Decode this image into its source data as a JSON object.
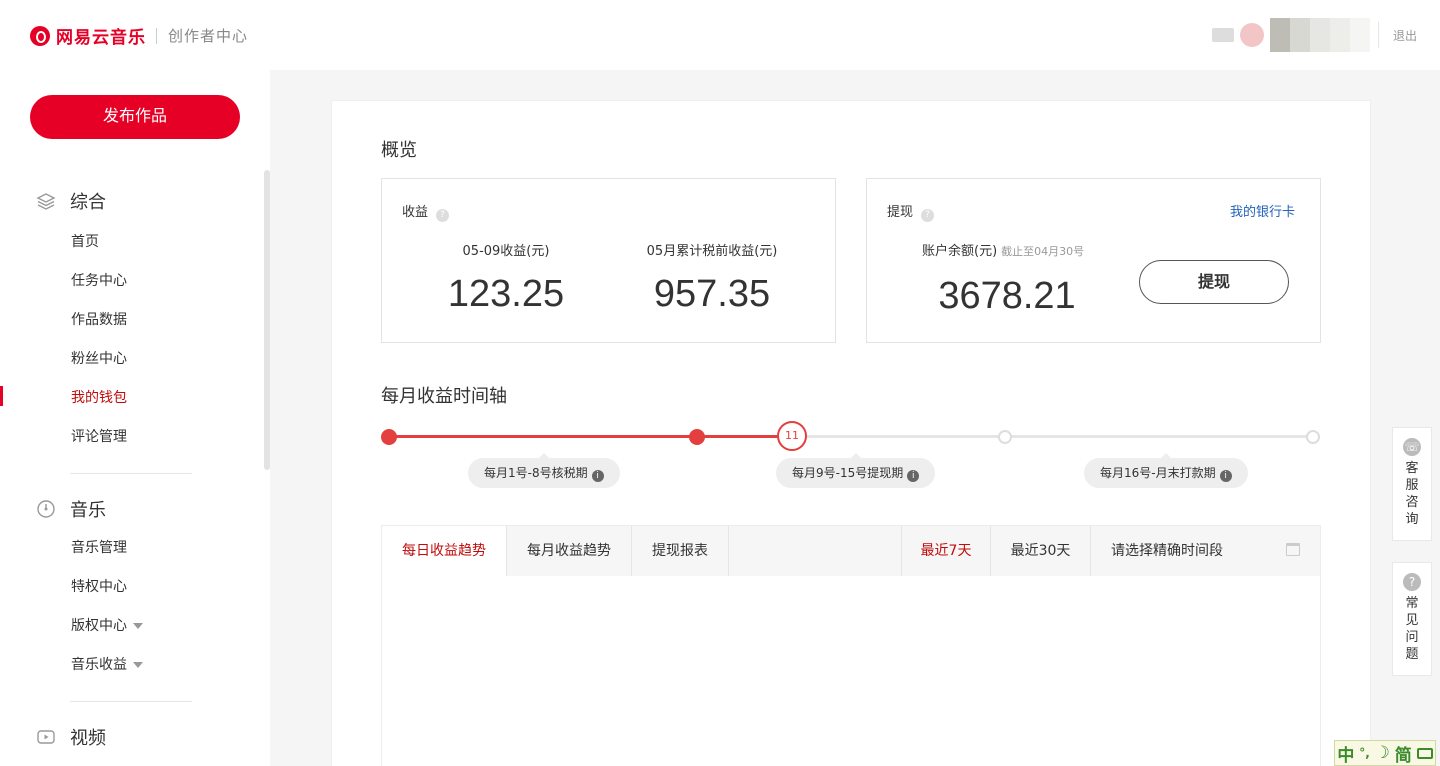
{
  "header": {
    "brand": "网易云音乐",
    "subtitle": "创作者中心",
    "logout": "退出"
  },
  "sidebar": {
    "publish_label": "发布作品",
    "groups": [
      {
        "title": "综合",
        "icon": "layers-icon",
        "items": [
          {
            "label": "首页"
          },
          {
            "label": "任务中心"
          },
          {
            "label": "作品数据"
          },
          {
            "label": "粉丝中心"
          },
          {
            "label": "我的钱包",
            "active": true
          },
          {
            "label": "评论管理"
          }
        ]
      },
      {
        "title": "音乐",
        "icon": "disc-icon",
        "items": [
          {
            "label": "音乐管理"
          },
          {
            "label": "特权中心"
          },
          {
            "label": "版权中心",
            "dropdown": true
          },
          {
            "label": "音乐收益",
            "dropdown": true
          }
        ]
      },
      {
        "title": "视频",
        "icon": "video-icon",
        "items": []
      }
    ]
  },
  "overview": {
    "title": "概览",
    "income": {
      "label": "收益",
      "daily_label": "05-09收益(元)",
      "daily_value": "123.25",
      "monthly_label": "05月累计税前收益(元)",
      "monthly_value": "957.35"
    },
    "withdraw": {
      "label": "提现",
      "bank_link": "我的银行卡",
      "balance_label": "账户余额(元)",
      "balance_note": "截止至04月30号",
      "balance_value": "3678.21",
      "button_label": "提现"
    }
  },
  "timeline": {
    "title": "每月收益时间轴",
    "current_day": "11",
    "tags": [
      {
        "label": "每月1号-8号核税期"
      },
      {
        "label": "每月9号-15号提现期"
      },
      {
        "label": "每月16号-月末打款期"
      }
    ]
  },
  "tabs": {
    "left": [
      "每日收益趋势",
      "每月收益趋势",
      "提现报表"
    ],
    "range": [
      "最近7天",
      "最近30天"
    ],
    "date_placeholder": "请选择精确时间段"
  },
  "floating": {
    "service": "客服咨询",
    "faq": "常见问题"
  },
  "ime": {
    "mode": "中",
    "punct": "°,",
    "moon": "☽",
    "variant": "简"
  },
  "colors": {
    "brand_red": "#e60026",
    "active_text": "#c20c0c",
    "timeline_red": "#e33f3f",
    "link_blue": "#2263b7"
  }
}
